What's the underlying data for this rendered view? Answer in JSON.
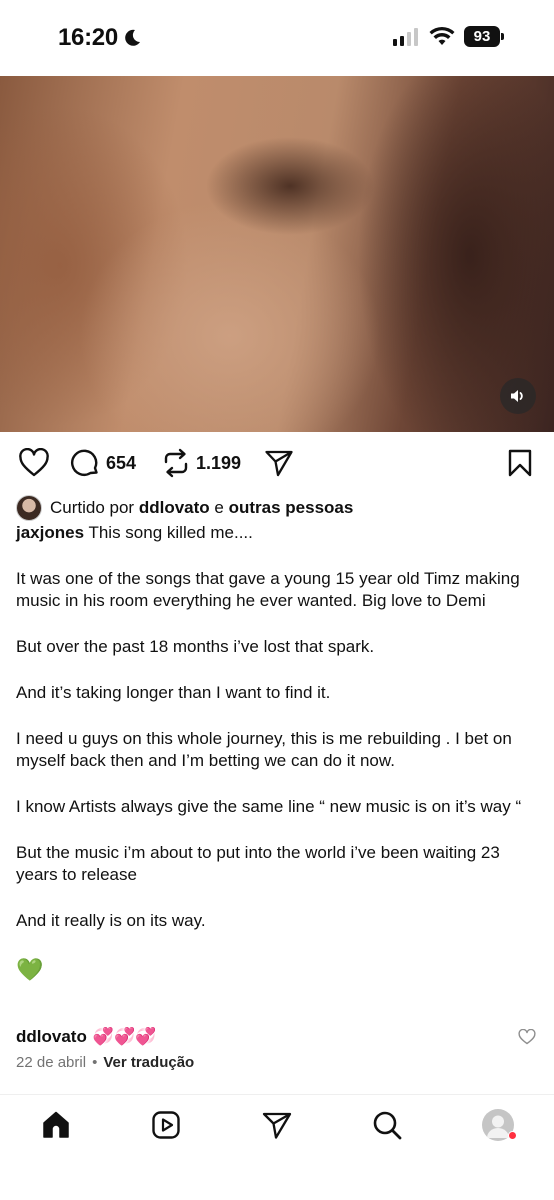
{
  "status_bar": {
    "time": "16:20",
    "battery": "93"
  },
  "post": {
    "actions": {
      "comments": "654",
      "reposts": "1.199"
    },
    "likes": {
      "prefix": "Curtido por",
      "user": "ddlovato",
      "conj": "e",
      "others": "outras pessoas"
    },
    "caption": {
      "username": "jaxjones",
      "first_line": "This song killed me....",
      "paragraphs": [
        "It was one of the songs that gave a young 15 year old Timz making music in his room everything he ever wanted. Big love to Demi",
        "But over the past 18 months i’ve lost that spark.",
        "And it’s taking longer than I want to find it.",
        "I need u guys on this whole journey, this is me rebuilding . I bet on myself back then and I’m betting we can do it now.",
        "I know Artists always give the same line “ new music is on it’s way “",
        "But the music i’m about to put into the world i’ve been waiting 23 years to release",
        "And it really is on its way."
      ],
      "emoji": "💚"
    },
    "comment": {
      "user": "ddlovato",
      "text": "💞💞💞"
    },
    "meta": {
      "date": "22 de abril",
      "separator": "•",
      "translate": "Ver tradução"
    }
  },
  "nav": {
    "items": [
      "home-icon",
      "reels-icon",
      "send-icon",
      "search-icon",
      "profile-avatar"
    ]
  }
}
